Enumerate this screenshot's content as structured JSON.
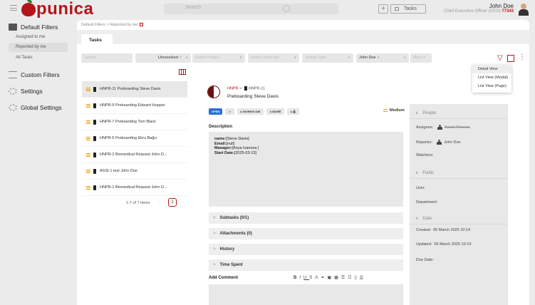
{
  "app": {
    "logo_text": "punica",
    "brand_color": "#b3151b"
  },
  "search": {
    "placeholder": "Search"
  },
  "topbar": {
    "tasks_label": "Tasks",
    "user_name": "John Doe",
    "user_role": "Chief Executive Officer (CEO)",
    "user_id": "77343"
  },
  "sidebar": {
    "default_filters": "Default Filters",
    "subitems": [
      "Assigned to me",
      "Reported by me",
      "All Tasks"
    ],
    "custom_filters": "Custom Filters",
    "settings": "Settings",
    "global_settings": "Global Settings"
  },
  "breadcrumb": {
    "part1": "Default Filters",
    "sep": ">",
    "part2": "Reported by me"
  },
  "tabs": {
    "tasks": "Tasks"
  },
  "filters": {
    "search": "Search",
    "status": "Unresolved",
    "project": "Select Project",
    "tasktype": "Select TaskType",
    "type": "Select Type",
    "reporter": "John Doe",
    "more": "More"
  },
  "view_menu": [
    "Detail View",
    "List View (Modal)",
    "List View (Page)"
  ],
  "tasks": [
    "HNPR-11 Preboarding Steve Davis",
    "HNPR-9 Preboarding Edward Hopper",
    "HNPR-7 Preboarding Tom Black",
    "HNPR-5 Preboarding Ebru Bağcı",
    "HNPR-2 Biomedical Request John D...",
    "ASSI-1 test John Doe",
    "HNPR-1 Biomedical Request John D..."
  ],
  "pager": {
    "summary": "1-7 of 7 items",
    "page": "1"
  },
  "detail": {
    "project": "HNPR",
    "key": "HNPR-11",
    "title": "Preboarding Steve Davis",
    "status": "OPEN",
    "workflow": "WORKFLOW",
    "more": "MORE",
    "priority": "Medium",
    "description_label": "Description",
    "desc_lines": [
      {
        "k": "name:",
        "v": "[Steve Davis]"
      },
      {
        "k": "Email:",
        "v": "[null]"
      },
      {
        "k": "Manager:",
        "v": "[Anya Ivanova ]"
      },
      {
        "k": "Start Date:",
        "v": "[2025-03-13]"
      }
    ],
    "subtasks": "Subtasks (0/1)",
    "attachments": "Attachments (0)",
    "history": "History",
    "time_spent": "Time Spent",
    "add_comment": "Add Comment"
  },
  "side": {
    "people": "People",
    "assignee_label": "Assignee:",
    "assignee": "Barak Thomas",
    "reporter_label": "Reporter:",
    "reporter": "John Doe",
    "watchers_label": "Watchers:",
    "fields": "Fields",
    "user_label": "User:",
    "department_label": "Department:",
    "date": "Date",
    "created_label": "Created:",
    "created": "06 March 2025 10:14",
    "updated_label": "Updated:",
    "updated": "06 March 2025 10:14",
    "due_label": "Due Date:"
  }
}
